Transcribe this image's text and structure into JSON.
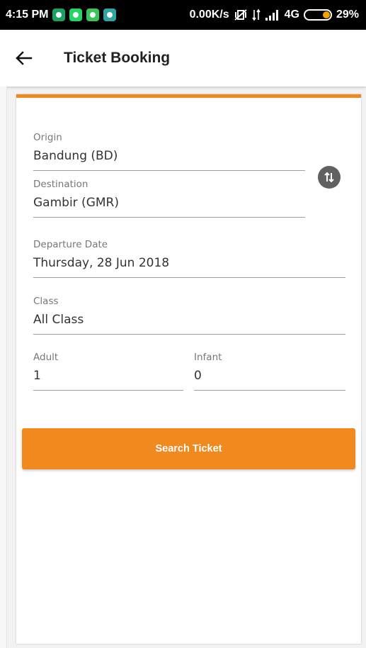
{
  "status_bar": {
    "time": "4:15 PM",
    "speed": "0.00K/s",
    "network": "4G",
    "battery": "29%"
  },
  "toolbar": {
    "title": "Ticket Booking"
  },
  "form": {
    "origin": {
      "label": "Origin",
      "value": "Bandung (BD)"
    },
    "destination": {
      "label": "Destination",
      "value": "Gambir (GMR)"
    },
    "departure_date": {
      "label": "Departure Date",
      "value": "Thursday, 28 Jun 2018"
    },
    "class": {
      "label": "Class",
      "value": "All Class"
    },
    "adult": {
      "label": "Adult",
      "value": "1"
    },
    "infant": {
      "label": "Infant",
      "value": "0"
    }
  },
  "search_button_label": "Search Ticket",
  "colors": {
    "accent": "#f0891e",
    "swap_icon": "#616161"
  }
}
